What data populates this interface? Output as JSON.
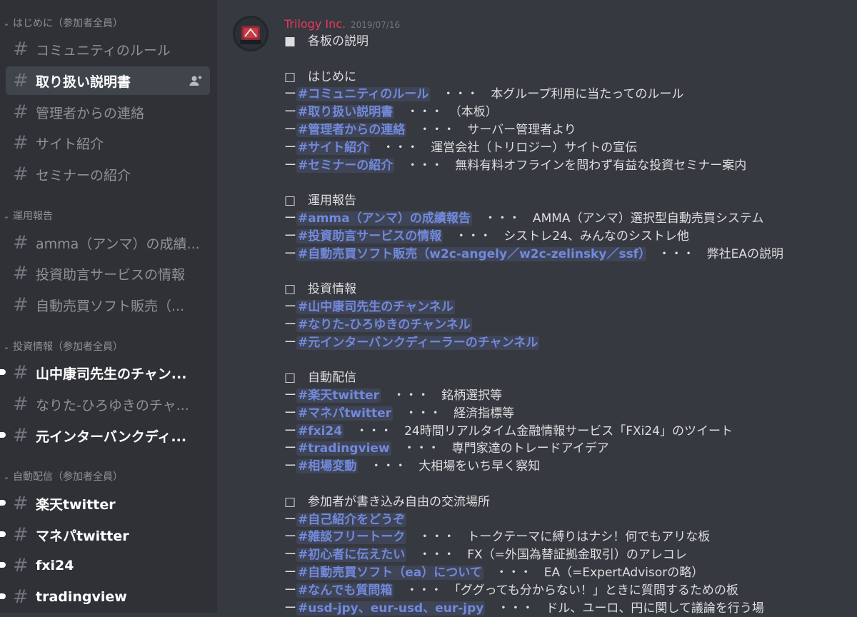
{
  "sidebar": {
    "categories": [
      {
        "label": "はじめに（参加者全員）"
      },
      {
        "label": "運用報告"
      },
      {
        "label": "投資情報（参加者全員）"
      },
      {
        "label": "自動配信（参加者全員）"
      }
    ],
    "channels": [
      {
        "label": "コミュニティのルール"
      },
      {
        "label": "取り扱い説明書"
      },
      {
        "label": "管理者からの連絡"
      },
      {
        "label": "サイト紹介"
      },
      {
        "label": "セミナーの紹介"
      },
      {
        "label": "amma（アンマ）の成績..."
      },
      {
        "label": "投資助言サービスの情報"
      },
      {
        "label": "自動売買ソフト販売（..."
      },
      {
        "label": "山中康司先生のチャン..."
      },
      {
        "label": "なりた-ひろゆきのチャ..."
      },
      {
        "label": "元インターバンクディ..."
      },
      {
        "label": "楽天twitter"
      },
      {
        "label": "マネパtwitter"
      },
      {
        "label": "fxi24"
      },
      {
        "label": "tradingview"
      }
    ]
  },
  "message": {
    "author": "Trilogy Inc.",
    "timestamp": "2019/07/16",
    "heading": "■　各板の説明",
    "sections": [
      {
        "title": "□　はじめに",
        "lines": [
          {
            "dash": "ー",
            "mention": "#コミュニティのルール",
            "desc": "・・・　本グループ利用に当たってのルール"
          },
          {
            "dash": "ー",
            "mention": "#取り扱い説明書",
            "desc": "・・・　（本板）"
          },
          {
            "dash": "ー",
            "mention": "#管理者からの連絡",
            "desc": "・・・　サーバー管理者より"
          },
          {
            "dash": "ー",
            "mention": "#サイト紹介",
            "desc": "・・・　運営会社（トリロジー）サイトの宣伝"
          },
          {
            "dash": "ー",
            "mention": "#セミナーの紹介",
            "desc": "・・・　無料有料オフラインを問わず有益な投資セミナー案内"
          }
        ]
      },
      {
        "title": "□　運用報告",
        "lines": [
          {
            "dash": "ー",
            "mention": "#amma（アンマ）の成績報告",
            "desc": "・・・　AMMA（アンマ）選択型自動売買システム"
          },
          {
            "dash": "ー",
            "mention": "#投資助言サービスの情報",
            "desc": "・・・　シストレ24、みんなのシストレ他"
          },
          {
            "dash": "ー",
            "mention": "#自動売買ソフト販売（w2c-angely／w2c-zelinsky／ssf）",
            "desc": "・・・　弊社EAの説明"
          }
        ]
      },
      {
        "title": "□　投資情報",
        "lines": [
          {
            "dash": "ー",
            "mention": "#山中康司先生のチャンネル",
            "desc": ""
          },
          {
            "dash": "ー",
            "mention": "#なりた-ひろゆきのチャンネル",
            "desc": ""
          },
          {
            "dash": "ー",
            "mention": "#元インターバンクディーラーのチャンネル",
            "desc": ""
          }
        ]
      },
      {
        "title": "□　自動配信",
        "lines": [
          {
            "dash": "ー",
            "mention": "#楽天twitter",
            "desc": "・・・　銘柄選択等"
          },
          {
            "dash": "ー",
            "mention": "#マネパtwitter",
            "desc": "・・・　経済指標等"
          },
          {
            "dash": "ー",
            "mention": "#fxi24",
            "desc": "・・・　24時間リアルタイム金融情報サービス「FXi24」のツイート"
          },
          {
            "dash": "ー",
            "mention": "#tradingview",
            "desc": "・・・　専門家達のトレードアイデア"
          },
          {
            "dash": "ー",
            "mention": "#相場変動",
            "desc": "・・・　大相場をいち早く察知"
          }
        ]
      },
      {
        "title": "□　参加者が書き込み自由の交流場所",
        "lines": [
          {
            "dash": "ー",
            "mention": "#自己紹介をどうぞ",
            "desc": ""
          },
          {
            "dash": "ー",
            "mention": "#雑談フリートーク",
            "desc": "・・・　トークテーマに縛りはナシ！何でもアリな板"
          },
          {
            "dash": "ー",
            "mention": "#初心者に伝えたい",
            "desc": "・・・　FX（=外国為替証拠金取引）のアレコレ"
          },
          {
            "dash": "ー",
            "mention": "#自動売買ソフト（ea）について",
            "desc": "・・・　EA（=ExpertAdvisorの略）"
          },
          {
            "dash": "ー",
            "mention": "#なんでも質問箱",
            "desc": "・・・　「ググっても分からない！」ときに質問するための板"
          },
          {
            "dash": "ー",
            "mention": "#usd-jpy、eur-usd、eur-jpy",
            "desc": "・・・　ドル、ユーロ、円に関して議論を行う場"
          }
        ]
      }
    ]
  },
  "colors": {
    "sidebar_bg": "#2f3136",
    "chat_bg": "#36393f",
    "mention": "#7289da",
    "author": "#e73a5b"
  }
}
